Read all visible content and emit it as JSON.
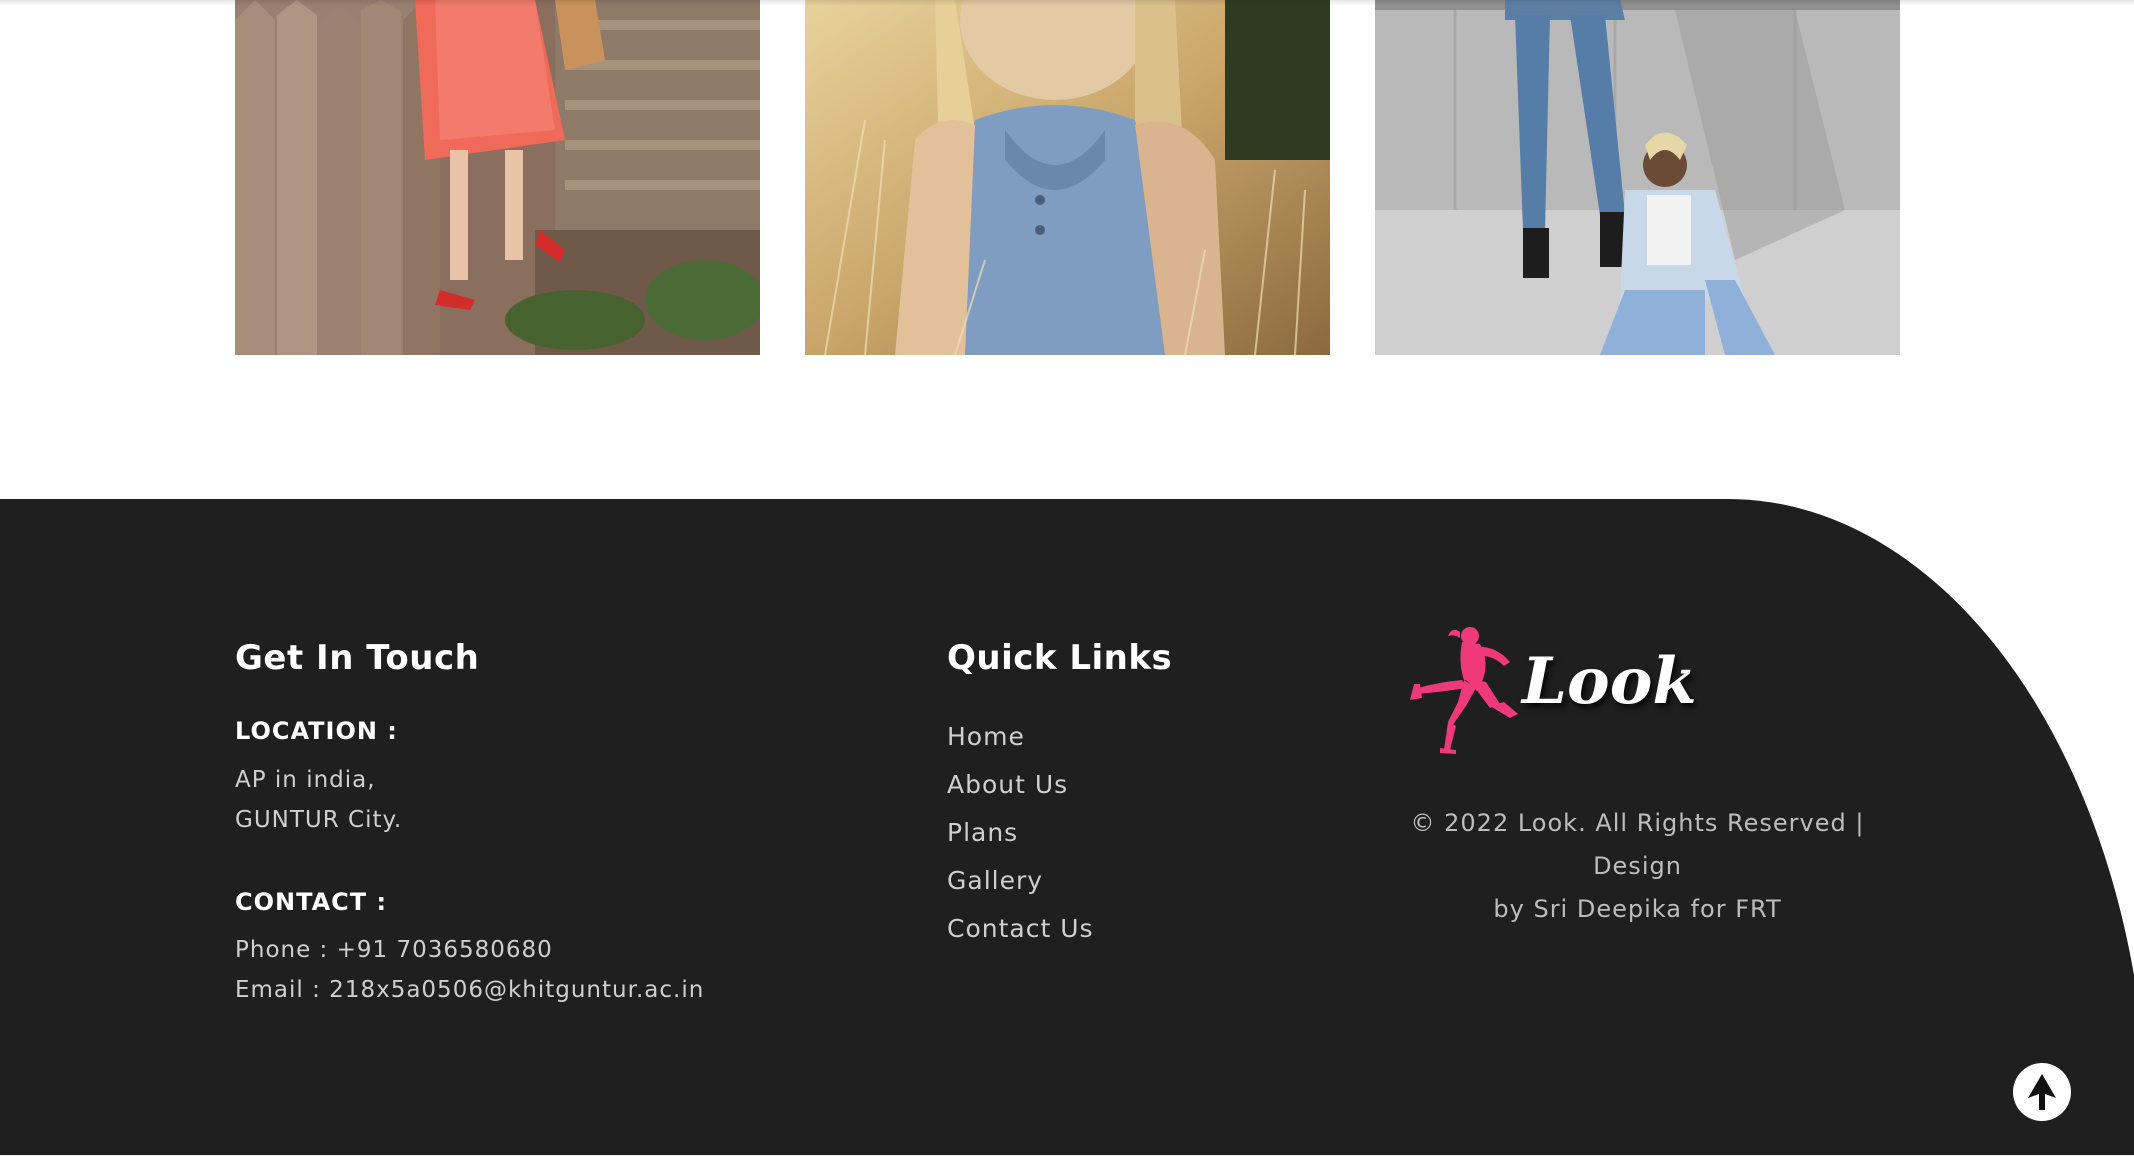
{
  "gallery": {
    "photos": [
      {
        "name": "woman in red dress by wooden fence"
      },
      {
        "name": "woman in denim top in wheat field"
      },
      {
        "name": "two people in denim by concrete wall"
      }
    ]
  },
  "footer": {
    "contact_section": {
      "heading": "Get In Touch",
      "location_label": "LOCATION :",
      "location_line1": "AP in india,",
      "location_line2": "GUNTUR City.",
      "contact_label": "CONTACT :",
      "phone": "Phone : +91 7036580680",
      "email": "Email : 218x5a0506@khitguntur.ac.in"
    },
    "quick_links": {
      "heading": "Quick Links",
      "items": [
        "Home",
        "About Us",
        "Plans",
        "Gallery",
        "Contact Us"
      ]
    },
    "brand": {
      "logo_text": "Look",
      "logo_color": "#ee3a78",
      "copyright_line1": "© 2022 Look. All Rights Reserved | Design",
      "copyright_line2": "by Sri Deepika for FRT"
    },
    "background_color": "#1f1f1f"
  },
  "back_to_top": {
    "icon": "arrow-up-icon"
  }
}
